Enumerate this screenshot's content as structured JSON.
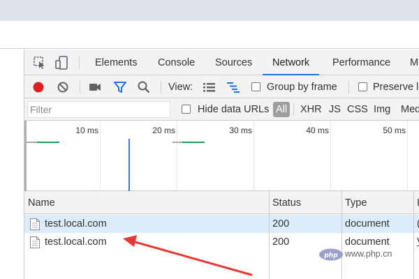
{
  "devtools": {
    "tabs": [
      "Elements",
      "Console",
      "Sources",
      "Network",
      "Performance",
      "M"
    ],
    "active_tab": "Network",
    "icons": {
      "inspect": "inspect-element-icon",
      "device": "device-toolbar-icon"
    }
  },
  "toolbar": {
    "record": {
      "icon": "record-icon",
      "color": "#e02020"
    },
    "clear": {
      "icon": "clear-icon"
    },
    "capture": {
      "icon": "video-camera-icon"
    },
    "filter": {
      "icon": "filter-icon",
      "color": "#1a73e8"
    },
    "search": {
      "icon": "search-icon"
    },
    "view_label": "View:",
    "view_list": {
      "icon": "large-rows-icon"
    },
    "view_waterfall": {
      "icon": "waterfall-icon",
      "color": "#1a73e8"
    },
    "group_by_frame": "Group by frame",
    "preserve_log": "Preserve lo"
  },
  "filterbar": {
    "placeholder": "Filter",
    "hide_data_urls": "Hide data URLs",
    "types": [
      "All",
      "XHR",
      "JS",
      "CSS",
      "Img",
      "Med"
    ],
    "selected_type": "All"
  },
  "overview": {
    "ticks": [
      "10 ms",
      "20 ms",
      "30 ms",
      "40 ms",
      "50 ms"
    ]
  },
  "table": {
    "columns": [
      "Name",
      "Status",
      "Type",
      "I"
    ],
    "rows": [
      {
        "name": "test.local.com",
        "status": "200",
        "type": "document",
        "extra": "(",
        "selected": true
      },
      {
        "name": "test.local.com",
        "status": "200",
        "type": "document",
        "extra": "V",
        "selected": false
      }
    ]
  },
  "annotation": {
    "arrow_color": "#e53935",
    "points_to": "test.local.com"
  },
  "watermark": {
    "text": "www.php.cn",
    "logo": "php"
  }
}
